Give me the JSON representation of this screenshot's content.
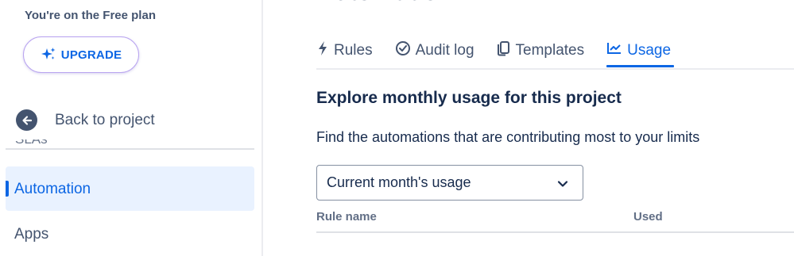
{
  "sidebar": {
    "plan_text": "You're on the Free plan",
    "upgrade_label": "UPGRADE",
    "back_label": "Back to project",
    "clipped_item": "SLAs",
    "items": [
      {
        "label": "Automation",
        "active": true
      },
      {
        "label": "Apps",
        "active": false
      }
    ]
  },
  "main": {
    "page_title": "Automation",
    "tabs": [
      {
        "label": "Rules",
        "icon": "lightning-icon"
      },
      {
        "label": "Audit log",
        "icon": "check-circle-icon"
      },
      {
        "label": "Templates",
        "icon": "copy-icon"
      },
      {
        "label": "Usage",
        "icon": "chart-line-icon",
        "active": true
      }
    ],
    "section_heading": "Explore monthly usage for this project",
    "section_desc": "Find the automations that are contributing most to your limits",
    "select_value": "Current month's usage",
    "columns": [
      "Rule name",
      "Used"
    ]
  },
  "colors": {
    "accent": "#0c66e4",
    "active_bg": "#e9f2ff",
    "text": "#172b4d",
    "subtle_text": "#44546f"
  }
}
